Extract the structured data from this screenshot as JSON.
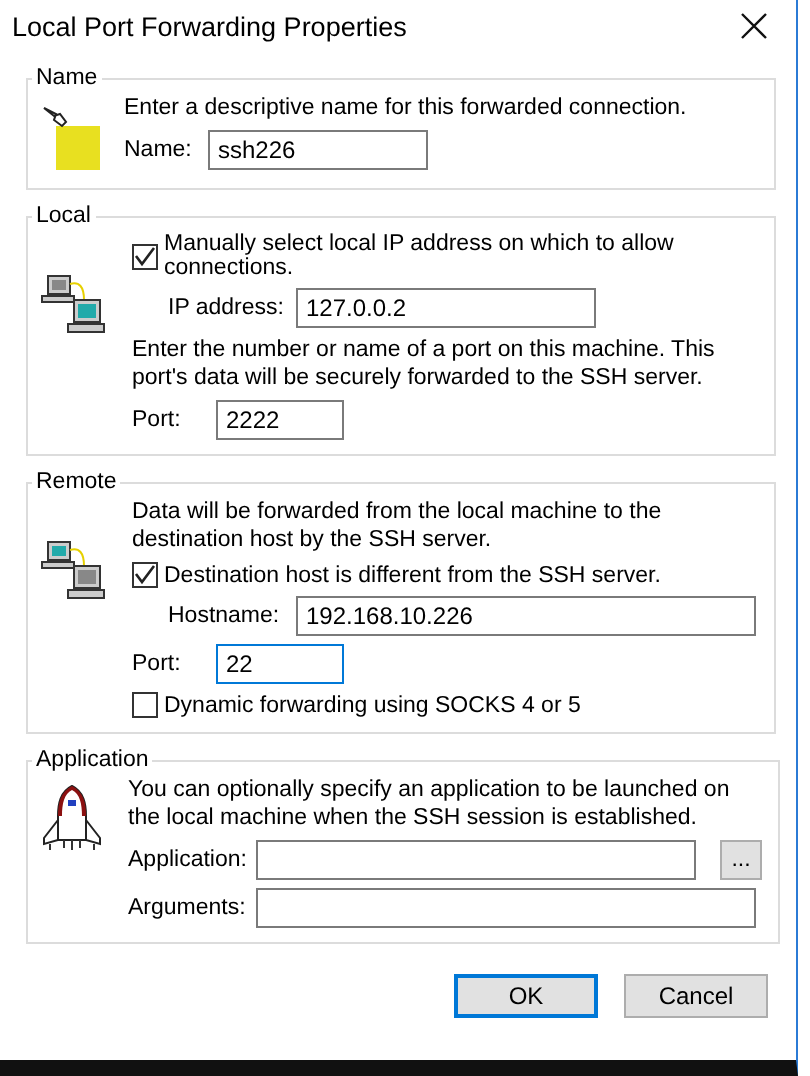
{
  "window": {
    "title": "Local Port Forwarding Properties"
  },
  "name_group": {
    "legend": "Name",
    "description": "Enter a descriptive name for this forwarded connection.",
    "name_label": "Name:",
    "name_value": "ssh226"
  },
  "local_group": {
    "legend": "Local",
    "manual_ip": {
      "label": "Manually select local IP address on which to allow connections.",
      "checked": true
    },
    "ip_label": "IP address:",
    "ip_value": "127.0.0.2",
    "description": "Enter the number or name of a port on this machine.  This port's data will be securely forwarded to the SSH server.",
    "port_label": "Port:",
    "port_value": "2222",
    "port_focused": false
  },
  "remote_group": {
    "legend": "Remote",
    "description": "Data will be forwarded from the local machine to the destination host by the SSH server.",
    "different_host": {
      "label": "Destination host is different from the SSH server.",
      "checked": true
    },
    "hostname_label": "Hostname:",
    "hostname_value": "192.168.10.226",
    "port_label": "Port:",
    "port_value": "22",
    "port_focused": true,
    "dynamic": {
      "label": "Dynamic forwarding using SOCKS 4 or 5",
      "checked": false
    }
  },
  "application_group": {
    "legend": "Application",
    "description": "You can optionally specify an application to be launched on the local machine when the SSH session is established.",
    "application_label": "Application:",
    "browse": "...",
    "arguments_label": "Arguments:"
  },
  "buttons": [
    {
      "label": "OK",
      "default": true
    },
    {
      "label": "Cancel",
      "default": false
    }
  ]
}
